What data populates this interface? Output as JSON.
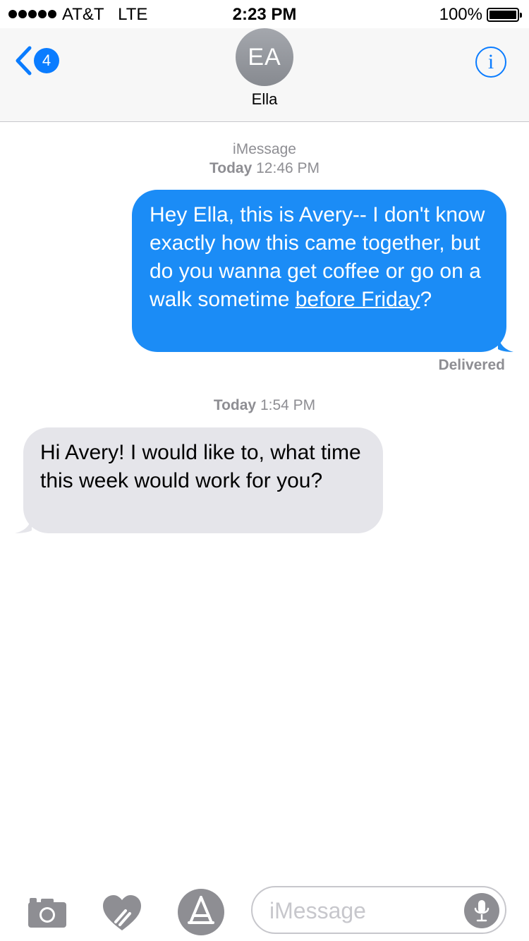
{
  "status_bar": {
    "carrier": "AT&T   LTE",
    "time": "2:23 PM",
    "battery": "100%"
  },
  "header": {
    "back_count": "4",
    "avatar_initials": "EA",
    "contact_name": "Ella",
    "info_glyph": "i"
  },
  "conversation": {
    "service": "iMessage",
    "first_time_day": "Today",
    "first_time": "12:46 PM",
    "sent_message": {
      "text_before": "Hey Ella, this is Avery-- I don't know exactly how this came together, but do you wanna get coffee or go on a walk sometime ",
      "link_text": "before Friday",
      "text_after": "?"
    },
    "delivered_label": "Delivered",
    "second_time_day": "Today",
    "second_time": "1:54 PM",
    "received_message": "Hi Avery! I would like to, what time this week would work for you?"
  },
  "composer": {
    "placeholder": "iMessage",
    "icons": [
      "camera-icon",
      "digital-touch-icon",
      "app-store-icon",
      "microphone-icon"
    ]
  },
  "colors": {
    "accent": "#0a7cff",
    "sent_bubble": "#1b8cf6",
    "received_bubble": "#e5e5ea",
    "muted_text": "#8e8e93"
  }
}
